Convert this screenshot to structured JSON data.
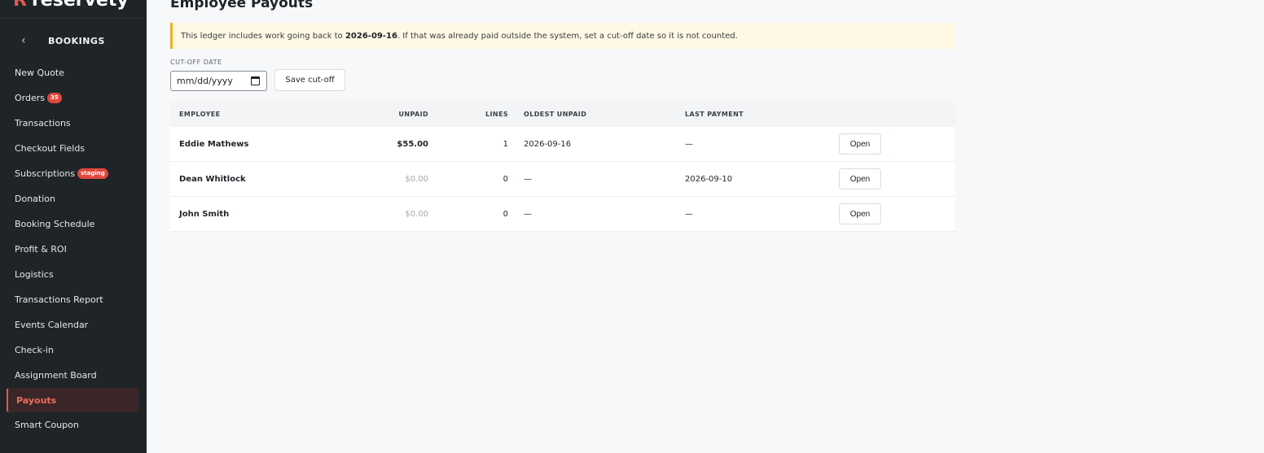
{
  "brand": {
    "logo_mark": "R",
    "logo_text": "reservety"
  },
  "sidebar": {
    "back_icon": "chevron-left-icon",
    "section_title": "BOOKINGS",
    "items": [
      {
        "label": "New Quote"
      },
      {
        "label": "Orders",
        "badge": "35"
      },
      {
        "label": "Transactions"
      },
      {
        "label": "Checkout Fields"
      },
      {
        "label": "Subscriptions",
        "badge": "staging"
      },
      {
        "label": "Donation"
      },
      {
        "label": "Booking Schedule"
      },
      {
        "label": "Profit & ROI"
      },
      {
        "label": "Logistics"
      },
      {
        "label": "Transactions Report"
      },
      {
        "label": "Events Calendar"
      },
      {
        "label": "Check-in"
      },
      {
        "label": "Assignment Board"
      },
      {
        "label": "Payouts",
        "active": true
      },
      {
        "label": "Smart Coupon"
      }
    ]
  },
  "main": {
    "title": "Employee Payouts",
    "notice": {
      "prefix": "This ledger includes work going back to ",
      "date": "2026-09-16",
      "suffix": ". If that was already paid outside the system, set a cut-off date so it is not counted."
    },
    "cutoff": {
      "label": "CUT-OFF DATE",
      "placeholder": "mm/dd/yyyy",
      "save_label": "Save cut-off"
    },
    "table": {
      "headers": {
        "employee": "EMPLOYEE",
        "unpaid": "UNPAID",
        "lines": "LINES",
        "oldest": "OLDEST UNPAID",
        "last": "LAST PAYMENT"
      },
      "rows": [
        {
          "employee": "Eddie Mathews",
          "unpaid": "$55.00",
          "lines": "1",
          "oldest": "2026-09-16",
          "last": "—",
          "action": "Open"
        },
        {
          "employee": "Dean Whitlock",
          "unpaid": "$0.00",
          "lines": "0",
          "oldest": "—",
          "last": "2026-09-10",
          "action": "Open"
        },
        {
          "employee": "John Smith",
          "unpaid": "$0.00",
          "lines": "0",
          "oldest": "—",
          "last": "—",
          "action": "Open"
        }
      ]
    }
  },
  "colors": {
    "accent": "#e45a4f",
    "sidebar_bg": "#1f2428",
    "notice_bg": "#fff8e4",
    "notice_border": "#e6b422"
  }
}
